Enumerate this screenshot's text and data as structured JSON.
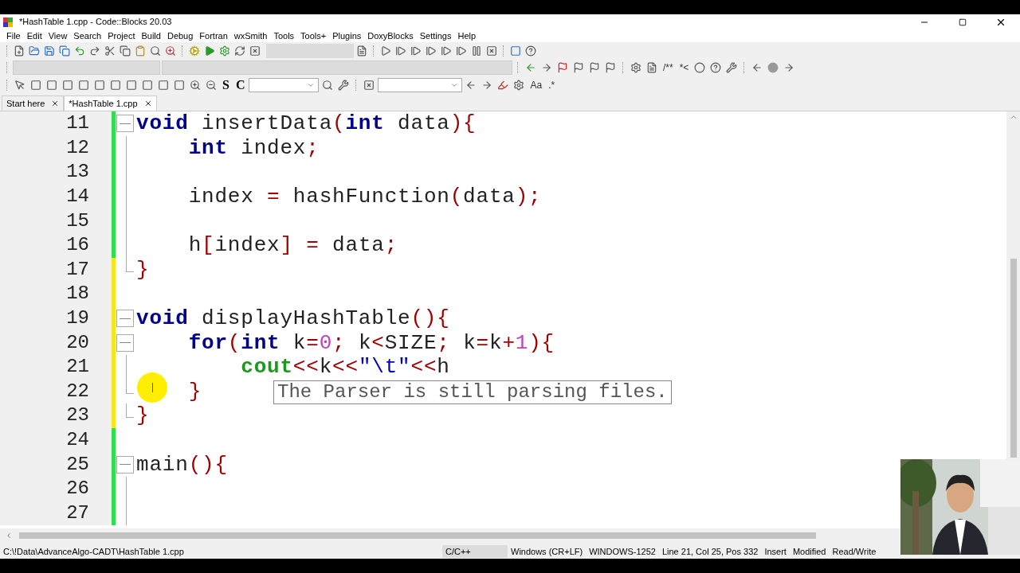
{
  "window": {
    "title": "*HashTable 1.cpp - Code::Blocks 20.03"
  },
  "menu": [
    "File",
    "Edit",
    "View",
    "Search",
    "Project",
    "Build",
    "Debug",
    "Fortran",
    "wxSmith",
    "Tools",
    "Tools+",
    "Plugins",
    "DoxyBlocks",
    "Settings",
    "Help"
  ],
  "toolbar_glyphs": [
    "/**",
    "*<",
    "S",
    "C",
    "Aa",
    ".*"
  ],
  "tabs": [
    {
      "label": "Start here",
      "selected": false
    },
    {
      "label": "*HashTable 1.cpp",
      "selected": true
    }
  ],
  "editor": {
    "lines": [
      {
        "number": "11",
        "modified": false,
        "kind": "start",
        "tokens": [
          {
            "kind": "kw",
            "text": "void"
          },
          {
            "kind": "id",
            "text": " insertData"
          },
          {
            "kind": "op",
            "text": "("
          },
          {
            "kind": "kw",
            "text": "int"
          },
          {
            "kind": "id",
            "text": " data"
          },
          {
            "kind": "op",
            "text": "){"
          }
        ]
      },
      {
        "number": "12",
        "modified": false,
        "kind": "body",
        "tokens": [
          {
            "kind": "kw",
            "text": "    int"
          },
          {
            "kind": "id",
            "text": " index"
          },
          {
            "kind": "op",
            "text": ";"
          }
        ]
      },
      {
        "number": "13",
        "modified": false,
        "kind": "body"
      },
      {
        "number": "14",
        "modified": false,
        "kind": "body",
        "tokens": [
          {
            "kind": "id",
            "text": "    index "
          },
          {
            "kind": "op",
            "text": "="
          },
          {
            "kind": "id",
            "text": " hashFunction"
          },
          {
            "kind": "op",
            "text": "("
          },
          {
            "kind": "id",
            "text": "data"
          },
          {
            "kind": "op",
            "text": ");"
          }
        ]
      },
      {
        "number": "15",
        "modified": false,
        "kind": "body"
      },
      {
        "number": "16",
        "modified": false,
        "kind": "body",
        "tokens": [
          {
            "kind": "id",
            "text": "    h"
          },
          {
            "kind": "op",
            "text": "["
          },
          {
            "kind": "id",
            "text": "index"
          },
          {
            "kind": "op",
            "text": "] ="
          },
          {
            "kind": "id",
            "text": " data"
          },
          {
            "kind": "op",
            "text": ";"
          }
        ]
      },
      {
        "number": "17",
        "modified": true,
        "kind": "end",
        "tokens": [
          {
            "kind": "op",
            "text": "}"
          }
        ]
      },
      {
        "number": "18",
        "modified": true,
        "kind": "plain"
      },
      {
        "number": "19",
        "modified": true,
        "kind": "start",
        "tokens": [
          {
            "kind": "kw",
            "text": "void"
          },
          {
            "kind": "id",
            "text": " displayHashTable"
          },
          {
            "kind": "op",
            "text": "(){"
          }
        ]
      },
      {
        "number": "20",
        "modified": true,
        "kind": "start",
        "tokens": [
          {
            "kind": "kw",
            "text": "    for"
          },
          {
            "kind": "op",
            "text": "("
          },
          {
            "kind": "kw",
            "text": "int"
          },
          {
            "kind": "id",
            "text": " k"
          },
          {
            "kind": "op",
            "text": "="
          },
          {
            "kind": "num",
            "text": "0"
          },
          {
            "kind": "op",
            "text": ";"
          },
          {
            "kind": "id",
            "text": " k"
          },
          {
            "kind": "op",
            "text": "<"
          },
          {
            "kind": "id",
            "text": "SIZE"
          },
          {
            "kind": "op",
            "text": ";"
          },
          {
            "kind": "id",
            "text": " k"
          },
          {
            "kind": "op",
            "text": "="
          },
          {
            "kind": "id",
            "text": "k"
          },
          {
            "kind": "op",
            "text": "+"
          },
          {
            "kind": "num",
            "text": "1"
          },
          {
            "kind": "op",
            "text": "){"
          }
        ]
      },
      {
        "number": "21",
        "modified": true,
        "kind": "body",
        "tokens": [
          {
            "kind": "fn",
            "text": "        cout"
          },
          {
            "kind": "op",
            "text": "<<"
          },
          {
            "kind": "id",
            "text": "k"
          },
          {
            "kind": "op",
            "text": "<<"
          },
          {
            "kind": "str",
            "text": "\"\\t\""
          },
          {
            "kind": "op",
            "text": "<<"
          },
          {
            "kind": "id",
            "text": "h"
          }
        ]
      },
      {
        "number": "22",
        "modified": true,
        "kind": "end",
        "tokens": [
          {
            "kind": "op",
            "text": "    }"
          }
        ]
      },
      {
        "number": "23",
        "modified": true,
        "kind": "end",
        "tokens": [
          {
            "kind": "op",
            "text": "}"
          }
        ]
      },
      {
        "number": "24",
        "modified": false,
        "kind": "plain"
      },
      {
        "number": "25",
        "modified": false,
        "kind": "start",
        "tokens": [
          {
            "kind": "id",
            "text": "main"
          },
          {
            "kind": "op",
            "text": "(){"
          }
        ]
      },
      {
        "number": "26",
        "modified": false,
        "kind": "body"
      },
      {
        "number": "27",
        "modified": false,
        "kind": "body"
      }
    ],
    "tooltip": "The Parser is still parsing files."
  },
  "status_bar": [
    {
      "text": "C:\\!Data\\AdvanceAlgo-CADT\\HashTable 1.cpp",
      "selected": false
    },
    {
      "text": "C/C++",
      "selected": true
    },
    {
      "text": "Windows (CR+LF)",
      "selected": false
    },
    {
      "text": "WINDOWS-1252",
      "selected": false
    },
    {
      "text": "Line 21, Col 25, Pos 332",
      "selected": false
    },
    {
      "text": "Insert",
      "selected": false
    },
    {
      "text": "Modified",
      "selected": false
    },
    {
      "text": "Read/Write",
      "selected": false
    }
  ],
  "webcam": {
    "kind": "picture"
  }
}
